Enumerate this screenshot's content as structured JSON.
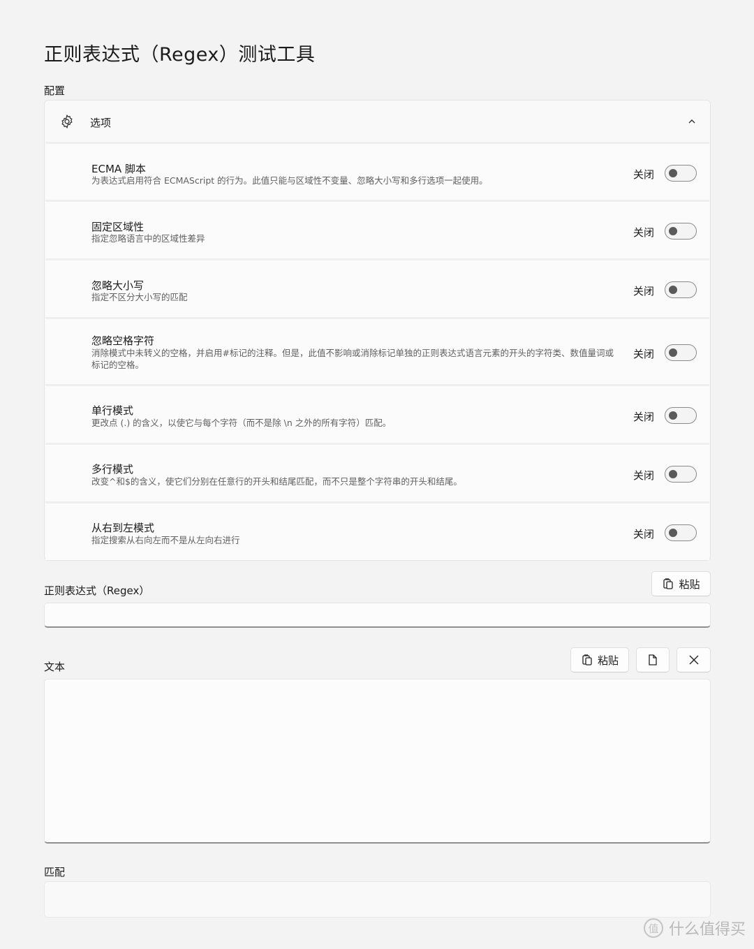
{
  "title": "正则表达式（Regex）测试工具",
  "config": {
    "section_label": "配置",
    "expander_label": "选项",
    "options": [
      {
        "title": "ECMA 脚本",
        "desc": "为表达式启用符合 ECMAScript 的行为。此值只能与区域性不变量、忽略大小写和多行选项一起使用。",
        "state": "关闭"
      },
      {
        "title": "固定区域性",
        "desc": "指定忽略语言中的区域性差异",
        "state": "关闭"
      },
      {
        "title": "忽略大小写",
        "desc": "指定不区分大小写的匹配",
        "state": "关闭"
      },
      {
        "title": "忽略空格字符",
        "desc": "消除模式中未转义的空格，并启用#标记的注释。但是，此值不影响或消除标记单独的正则表达式语言元素的开头的字符类、数值量词或标记的空格。",
        "state": "关闭"
      },
      {
        "title": "单行模式",
        "desc": "更改点 (.) 的含义，以使它与每个字符（而不是除 \\n 之外的所有字符）匹配。",
        "state": "关闭"
      },
      {
        "title": "多行模式",
        "desc": "改变^和$的含义，使它们分别在任意行的开头和结尾匹配，而不只是整个字符串的开头和结尾。",
        "state": "关闭"
      },
      {
        "title": "从右到左模式",
        "desc": "指定搜索从右向左而不是从左向右进行",
        "state": "关闭"
      }
    ]
  },
  "regex": {
    "label": "正则表达式（Regex）",
    "paste_label": "粘贴",
    "value": ""
  },
  "text": {
    "label": "文本",
    "paste_label": "粘贴",
    "value": ""
  },
  "match": {
    "label": "匹配",
    "value": ""
  },
  "watermark": {
    "icon_char": "值",
    "text": "什么值得买"
  },
  "icons": {
    "expander": "gear-icon",
    "collapse": "chevron-up-icon",
    "paste": "clipboard-icon",
    "open_file": "document-icon",
    "clear": "close-icon"
  }
}
